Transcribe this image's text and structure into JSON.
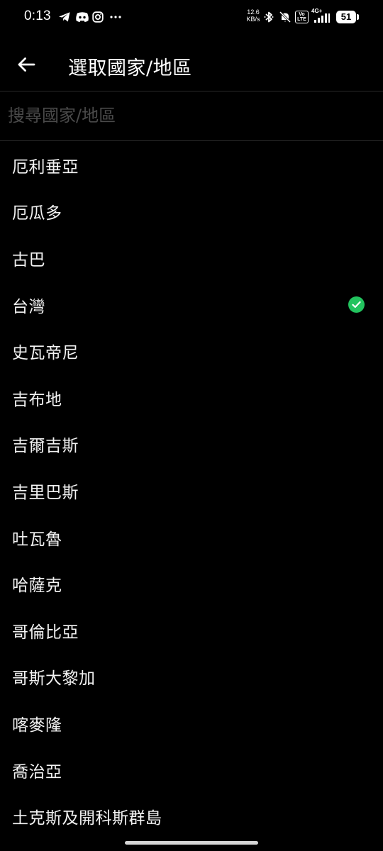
{
  "status_bar": {
    "time": "0:13",
    "icons": [
      "telegram-icon",
      "discord-icon",
      "instagram-icon",
      "more-dots-icon"
    ],
    "net_speed_value": "12.6",
    "net_speed_unit": "KB/s",
    "volte": "Vo LTE",
    "net_type": "4G+",
    "battery_level": "51"
  },
  "header": {
    "back_icon": "arrow-left-icon",
    "title": "選取國家/地區"
  },
  "search": {
    "placeholder": "搜尋國家/地區",
    "value": ""
  },
  "countries": [
    {
      "label": "厄利垂亞",
      "selected": false
    },
    {
      "label": "厄瓜多",
      "selected": false
    },
    {
      "label": "古巴",
      "selected": false
    },
    {
      "label": "台灣",
      "selected": true
    },
    {
      "label": "史瓦帝尼",
      "selected": false
    },
    {
      "label": "吉布地",
      "selected": false
    },
    {
      "label": "吉爾吉斯",
      "selected": false
    },
    {
      "label": "吉里巴斯",
      "selected": false
    },
    {
      "label": "吐瓦魯",
      "selected": false
    },
    {
      "label": "哈薩克",
      "selected": false
    },
    {
      "label": "哥倫比亞",
      "selected": false
    },
    {
      "label": "哥斯大黎加",
      "selected": false
    },
    {
      "label": "喀麥隆",
      "selected": false
    },
    {
      "label": "喬治亞",
      "selected": false
    },
    {
      "label": "土克斯及開科斯群島",
      "selected": false
    }
  ],
  "colors": {
    "background": "#000000",
    "text": "#f2f2f2",
    "placeholder": "#4a4a4a",
    "divider": "#2a2a2a",
    "selected_check": "#22c35e"
  }
}
